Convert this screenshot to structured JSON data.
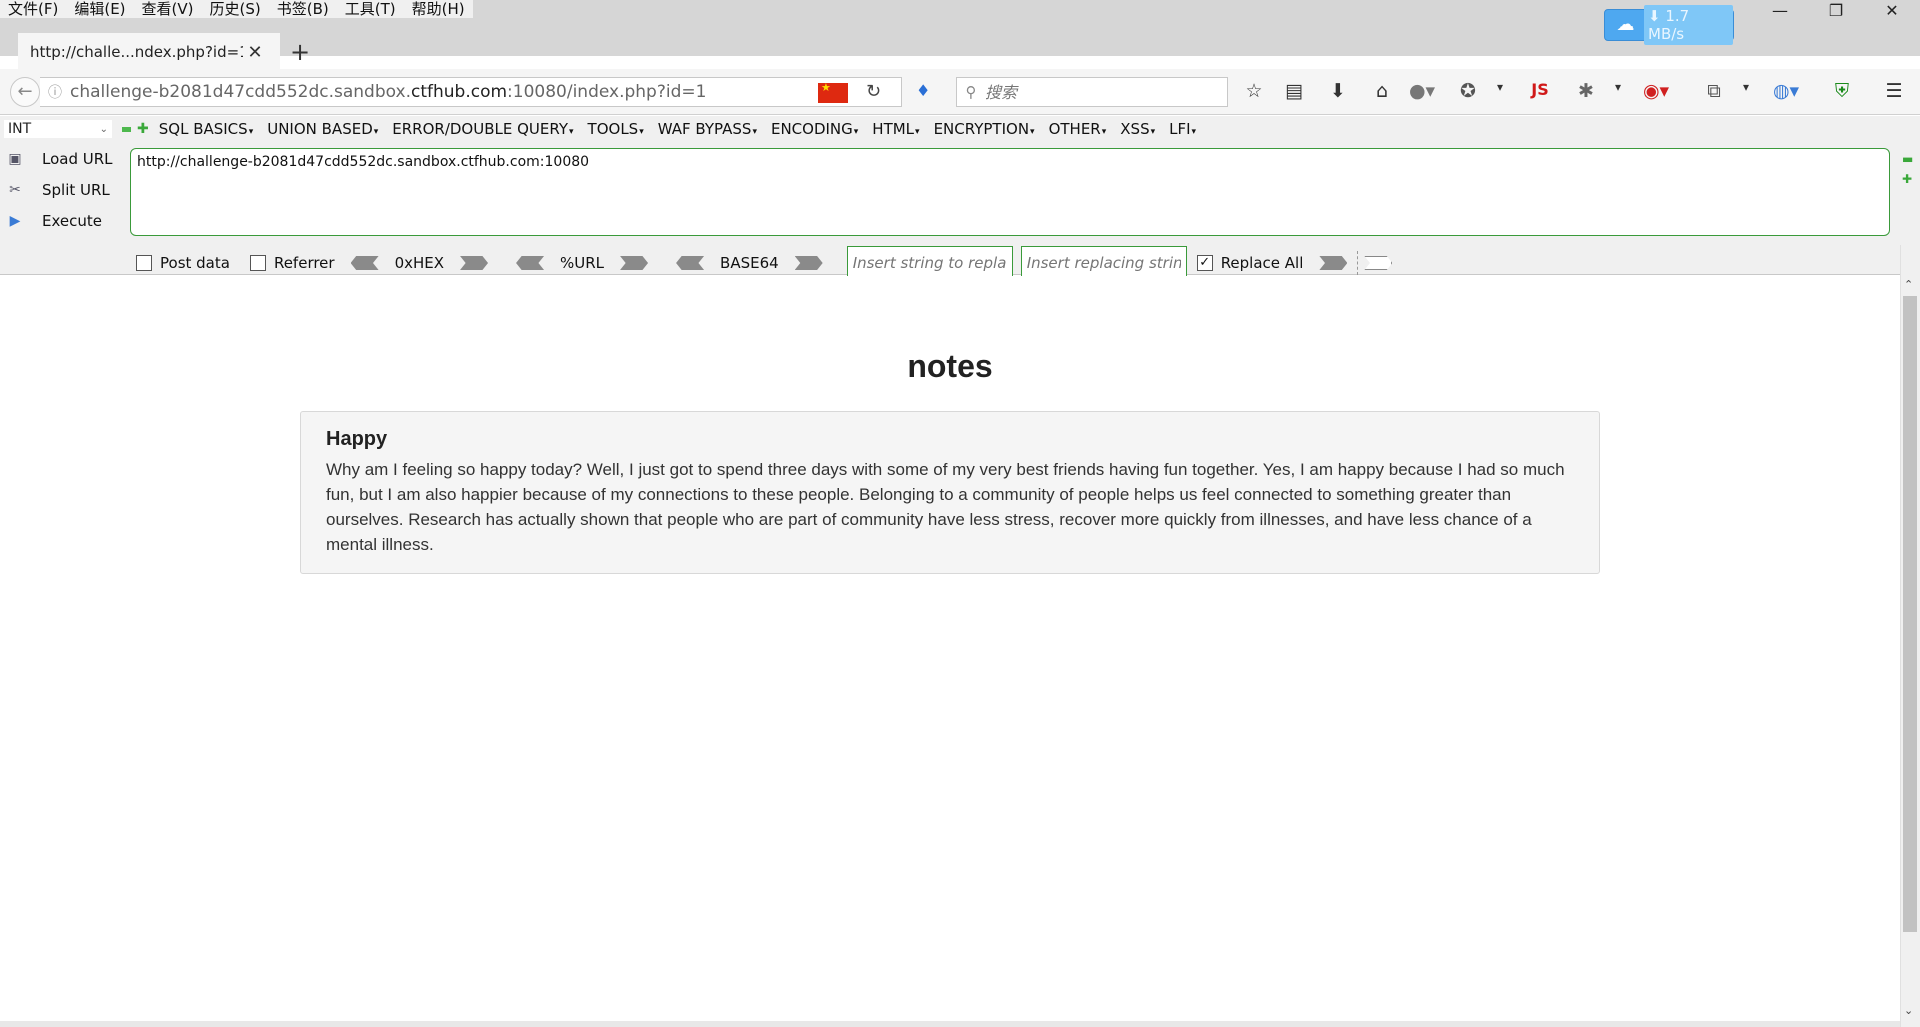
{
  "menubar": {
    "items": [
      "文件(F)",
      "编辑(E)",
      "查看(V)",
      "历史(S)",
      "书签(B)",
      "工具(T)",
      "帮助(H)"
    ]
  },
  "window_controls": {
    "minimize": "—",
    "restore": "❐",
    "close": "✕"
  },
  "download_badge": {
    "speed": "⬇ 1.7 MB/s"
  },
  "tab": {
    "title": "http://challe...ndex.php?id=1",
    "close": "✕",
    "new_tab": "+"
  },
  "navbar": {
    "url_plain": "challenge-b2081d47cdd552dc.sandbox.",
    "url_domain": "ctfhub.com",
    "url_rest": ":10080/index.php?id=1",
    "search_placeholder": "搜索"
  },
  "hackbar": {
    "type_select": "INT",
    "menu": [
      "SQL BASICS",
      "UNION BASED",
      "ERROR/DOUBLE QUERY",
      "TOOLS",
      "WAF BYPASS",
      "ENCODING",
      "HTML",
      "ENCRYPTION",
      "OTHER",
      "XSS",
      "LFI"
    ],
    "load_url": "Load URL",
    "split_url": "Split URL",
    "execute": "Execute",
    "url_value": "http://challenge-b2081d47cdd552dc.sandbox.ctfhub.com:10080",
    "post_data": "Post data",
    "referrer": "Referrer",
    "hex": "0xHEX",
    "url_enc": "%URL",
    "base64": "BASE64",
    "replace_from_placeholder": "Insert string to replace",
    "replace_to_placeholder": "Insert replacing string",
    "replace_all": "Replace All",
    "replace_all_checked": true
  },
  "page": {
    "heading": "notes",
    "note": {
      "title": "Happy",
      "body": "Why am I feeling so happy today? Well, I just got to spend three days with some of my very best friends having fun together. Yes, I am happy because I had so much fun, but I am also happier because of my connections to these people. Belonging to a community of people helps us feel connected to something greater than ourselves. Research has actually shown that people who are part of community have less stress, recover more quickly from illnesses, and have less chance of a mental illness."
    }
  },
  "colors": {
    "accent_green": "#3a9a3a",
    "download_blue": "#4ea8f0",
    "flag_red": "#de2910"
  }
}
